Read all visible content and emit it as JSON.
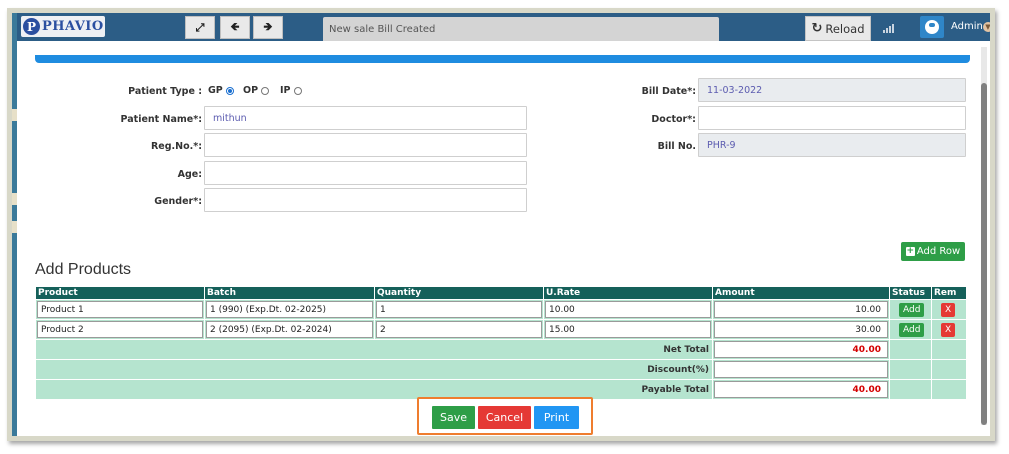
{
  "app": {
    "logo_initial": "P",
    "logo_text": "PHAVIO",
    "notification": "New sale Bill Created",
    "reload_label": "Reload",
    "user_name": "Admin"
  },
  "form": {
    "patient_type_label": "Patient Type :",
    "patient_types": [
      {
        "label": "GP",
        "selected": true
      },
      {
        "label": "OP",
        "selected": false
      },
      {
        "label": "IP",
        "selected": false
      }
    ],
    "patient_name_label": "Patient Name*:",
    "patient_name_value": "mithun",
    "reg_no_label": "Reg.No.*:",
    "reg_no_value": "",
    "age_label": "Age:",
    "age_value": "",
    "gender_label": "Gender*:",
    "gender_value": "",
    "bill_date_label": "Bill Date*:",
    "bill_date_value": "11-03-2022",
    "doctor_label": "Doctor*:",
    "doctor_value": "",
    "bill_no_label": "Bill No.",
    "bill_no_value": "PHR-9"
  },
  "products": {
    "title": "Add Products",
    "add_row_label": "Add Row",
    "headers": [
      "Product",
      "Batch",
      "Quantity",
      "U.Rate",
      "Amount",
      "Status",
      "Rem"
    ],
    "rows": [
      {
        "product": "Product 1",
        "batch": "1 (990) (Exp.Dt. 02-2025)",
        "quantity": "1",
        "rate": "10.00",
        "amount": "10.00",
        "status": "Add",
        "remove": "X"
      },
      {
        "product": "Product 2",
        "batch": "2 (2095) (Exp.Dt. 02-2024)",
        "quantity": "2",
        "rate": "15.00",
        "amount": "30.00",
        "status": "Add",
        "remove": "X"
      }
    ],
    "net_total_label": "Net Total",
    "net_total_value": "40.00",
    "discount_label": "Discount(%)",
    "discount_value": "",
    "payable_label": "Payable Total",
    "payable_value": "40.00"
  },
  "actions": {
    "save": "Save",
    "cancel": "Cancel",
    "print": "Print"
  },
  "colors": {
    "header_bg": "#2c5d86",
    "table_header": "#15605a",
    "table_row": "#b5e4cf",
    "save": "#2e9e47",
    "cancel": "#e53935",
    "print": "#2196f3",
    "highlight": "#ef7d2e"
  }
}
